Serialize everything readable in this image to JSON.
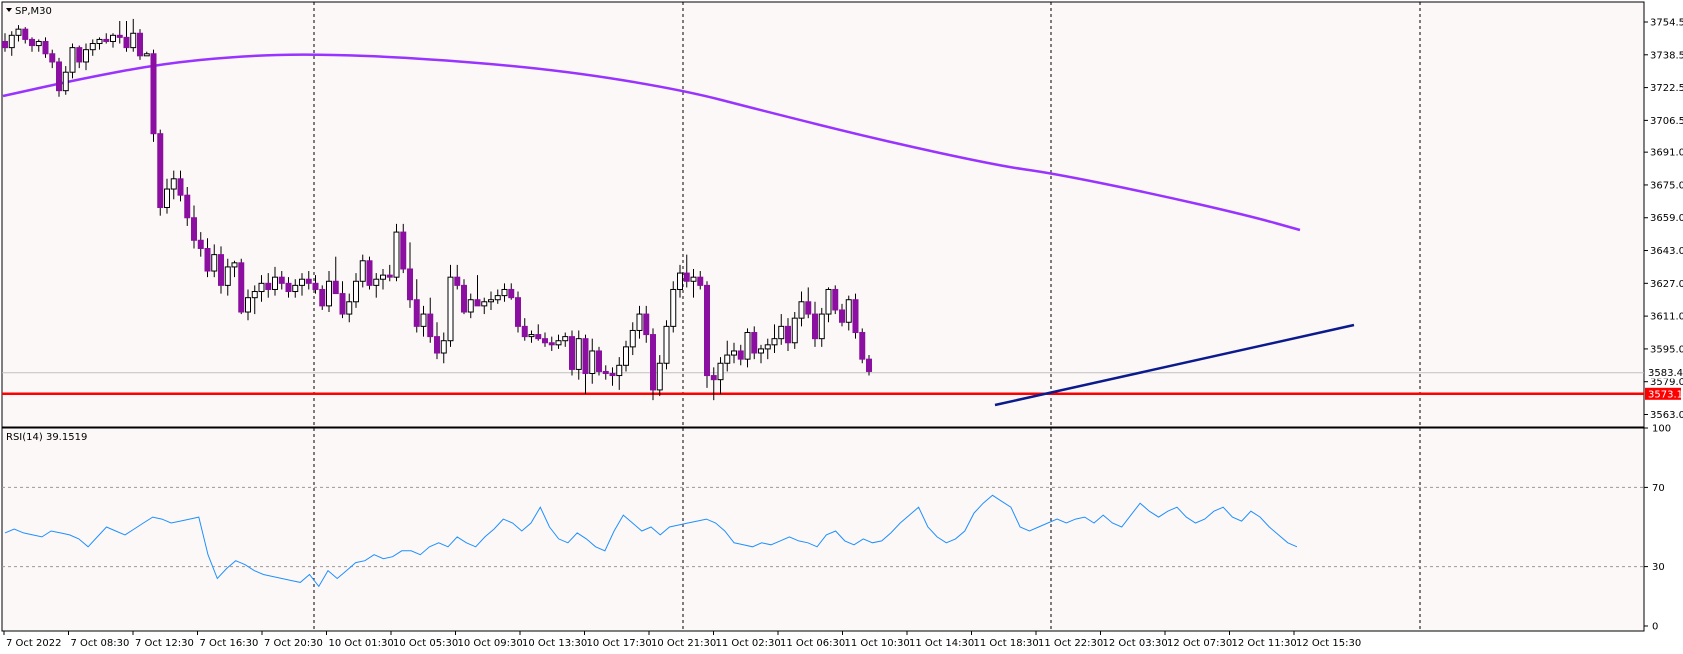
{
  "window": {
    "symbol_timeframe": "SP,M30",
    "rsi_label": "RSI(14) 39.1519"
  },
  "colors": {
    "background": "#fdf8f8",
    "bull_candle": "#ffffff",
    "bear_candle": "#8b0fa0",
    "moving_average": "#9933ff",
    "trendline": "#0b1a8c",
    "support_line": "#ff0000",
    "rsi_line": "#1e90ff",
    "current_price_line": "#c0c0c0"
  },
  "chart_data": [
    {
      "type": "candlestick",
      "title": "SP,M30",
      "y_ticks": [
        "3754.5",
        "3738.5",
        "3722.5",
        "3706.5",
        "3691.0",
        "3675.0",
        "3659.0",
        "3643.0",
        "3627.0",
        "3611.0",
        "3595.0",
        "3579.0",
        "3563.0"
      ],
      "ylim": [
        3558,
        3762
      ],
      "x_ticks": [
        "7 Oct 2022",
        "7 Oct 08:30",
        "7 Oct 12:30",
        "7 Oct 16:30",
        "7 Oct 20:30",
        "10 Oct 01:30",
        "10 Oct 05:30",
        "10 Oct 09:30",
        "10 Oct 13:30",
        "10 Oct 17:30",
        "10 Oct 21:30",
        "11 Oct 02:30",
        "11 Oct 06:30",
        "11 Oct 10:30",
        "11 Oct 14:30",
        "11 Oct 18:30",
        "11 Oct 22:30",
        "12 Oct 03:30",
        "12 Oct 07:30",
        "12 Oct 11:30",
        "12 Oct 15:30"
      ],
      "grid": "vertical dashed separators",
      "current_price": {
        "value": 3583.4,
        "label": "3583.4"
      },
      "support_level": {
        "value": 3573.1,
        "label": "3573.1"
      },
      "ohlc": [
        [
          3745,
          3749,
          3740,
          3742
        ],
        [
          3742,
          3750,
          3738,
          3748
        ],
        [
          3748,
          3753,
          3745,
          3751
        ],
        [
          3751,
          3752,
          3744,
          3746
        ],
        [
          3746,
          3747,
          3740,
          3743
        ],
        [
          3743,
          3746,
          3740,
          3745
        ],
        [
          3745,
          3747,
          3737,
          3739
        ],
        [
          3739,
          3741,
          3732,
          3735
        ],
        [
          3735,
          3737,
          3718,
          3721
        ],
        [
          3721,
          3733,
          3719,
          3730
        ],
        [
          3730,
          3744,
          3727,
          3742
        ],
        [
          3742,
          3743,
          3732,
          3735
        ],
        [
          3735,
          3744,
          3731,
          3741
        ],
        [
          3741,
          3746,
          3738,
          3744
        ],
        [
          3744,
          3747,
          3741,
          3746
        ],
        [
          3746,
          3749,
          3744,
          3745
        ],
        [
          3745,
          3749,
          3742,
          3748
        ],
        [
          3748,
          3755,
          3744,
          3747
        ],
        [
          3747,
          3755,
          3740,
          3742
        ],
        [
          3742,
          3756,
          3740,
          3749
        ],
        [
          3749,
          3751,
          3736,
          3738
        ],
        [
          3738,
          3740,
          3738,
          3739
        ],
        [
          3739,
          3741,
          3696,
          3700
        ],
        [
          3700,
          3702,
          3660,
          3664
        ],
        [
          3664,
          3678,
          3661,
          3673
        ],
        [
          3673,
          3682,
          3668,
          3678
        ],
        [
          3678,
          3682,
          3667,
          3670
        ],
        [
          3670,
          3674,
          3655,
          3659
        ],
        [
          3659,
          3665,
          3644,
          3648
        ],
        [
          3648,
          3652,
          3640,
          3644
        ],
        [
          3644,
          3649,
          3630,
          3633
        ],
        [
          3633,
          3646,
          3630,
          3641
        ],
        [
          3641,
          3645,
          3622,
          3626
        ],
        [
          3626,
          3639,
          3621,
          3635
        ],
        [
          3635,
          3638,
          3630,
          3637
        ],
        [
          3637,
          3639,
          3612,
          3613
        ],
        [
          3613,
          3624,
          3609,
          3620
        ],
        [
          3620,
          3626,
          3612,
          3623
        ],
        [
          3623,
          3631,
          3618,
          3627
        ],
        [
          3627,
          3632,
          3620,
          3624
        ],
        [
          3624,
          3635,
          3621,
          3630
        ],
        [
          3630,
          3633,
          3624,
          3627
        ],
        [
          3627,
          3630,
          3620,
          3623
        ],
        [
          3623,
          3629,
          3620,
          3626
        ],
        [
          3626,
          3632,
          3621,
          3629
        ],
        [
          3629,
          3633,
          3624,
          3627
        ],
        [
          3627,
          3631,
          3622,
          3624
        ],
        [
          3624,
          3626,
          3614,
          3616
        ],
        [
          3616,
          3633,
          3613,
          3628
        ],
        [
          3628,
          3640,
          3622,
          3622
        ],
        [
          3622,
          3628,
          3610,
          3612
        ],
        [
          3612,
          3622,
          3608,
          3618
        ],
        [
          3618,
          3632,
          3615,
          3628
        ],
        [
          3628,
          3641,
          3625,
          3638
        ],
        [
          3638,
          3640,
          3624,
          3626
        ],
        [
          3626,
          3632,
          3620,
          3629
        ],
        [
          3629,
          3634,
          3624,
          3631
        ],
        [
          3631,
          3636,
          3628,
          3630
        ],
        [
          3630,
          3656,
          3628,
          3652
        ],
        [
          3652,
          3656,
          3632,
          3634
        ],
        [
          3634,
          3647,
          3615,
          3619
        ],
        [
          3619,
          3629,
          3603,
          3606
        ],
        [
          3606,
          3616,
          3601,
          3612
        ],
        [
          3612,
          3620,
          3598,
          3601
        ],
        [
          3601,
          3608,
          3590,
          3593
        ],
        [
          3593,
          3603,
          3588,
          3599
        ],
        [
          3599,
          3636,
          3596,
          3630
        ],
        [
          3630,
          3636,
          3624,
          3626
        ],
        [
          3626,
          3629,
          3612,
          3613
        ],
        [
          3613,
          3622,
          3610,
          3619
        ],
        [
          3619,
          3631,
          3616,
          3616
        ],
        [
          3616,
          3620,
          3612,
          3618
        ],
        [
          3618,
          3623,
          3614,
          3619
        ],
        [
          3619,
          3624,
          3617,
          3621
        ],
        [
          3621,
          3627,
          3618,
          3624
        ],
        [
          3624,
          3627,
          3619,
          3620
        ],
        [
          3620,
          3623,
          3603,
          3606
        ],
        [
          3606,
          3610,
          3599,
          3601
        ],
        [
          3601,
          3604,
          3598,
          3602
        ],
        [
          3602,
          3607,
          3599,
          3600
        ],
        [
          3600,
          3603,
          3596,
          3598
        ],
        [
          3598,
          3601,
          3594,
          3597
        ],
        [
          3597,
          3602,
          3595,
          3599
        ],
        [
          3599,
          3603,
          3596,
          3601
        ],
        [
          3601,
          3604,
          3582,
          3585
        ],
        [
          3585,
          3604,
          3580,
          3600
        ],
        [
          3600,
          3602,
          3573,
          3583
        ],
        [
          3583,
          3600,
          3578,
          3594
        ],
        [
          3594,
          3596,
          3582,
          3584
        ],
        [
          3584,
          3587,
          3580,
          3583
        ],
        [
          3583,
          3586,
          3577,
          3582
        ],
        [
          3582,
          3591,
          3575,
          3587
        ],
        [
          3587,
          3599,
          3584,
          3596
        ],
        [
          3596,
          3608,
          3592,
          3604
        ],
        [
          3604,
          3616,
          3600,
          3612
        ],
        [
          3612,
          3616,
          3598,
          3602
        ],
        [
          3602,
          3605,
          3570,
          3575
        ],
        [
          3575,
          3592,
          3572,
          3588
        ],
        [
          3588,
          3609,
          3585,
          3606
        ],
        [
          3606,
          3628,
          3603,
          3624
        ],
        [
          3624,
          3636,
          3620,
          3632
        ],
        [
          3632,
          3641,
          3625,
          3628
        ],
        [
          3628,
          3634,
          3620,
          3630
        ],
        [
          3630,
          3633,
          3624,
          3626
        ],
        [
          3626,
          3628,
          3576,
          3582
        ],
        [
          3582,
          3586,
          3570,
          3580
        ],
        [
          3580,
          3591,
          3573,
          3588
        ],
        [
          3588,
          3599,
          3584,
          3592
        ],
        [
          3592,
          3598,
          3588,
          3594
        ],
        [
          3594,
          3597,
          3587,
          3590
        ],
        [
          3590,
          3605,
          3586,
          3603
        ],
        [
          3603,
          3606,
          3590,
          3593
        ],
        [
          3593,
          3597,
          3588,
          3595
        ],
        [
          3595,
          3600,
          3590,
          3597
        ],
        [
          3597,
          3607,
          3593,
          3600
        ],
        [
          3600,
          3612,
          3597,
          3606
        ],
        [
          3606,
          3610,
          3594,
          3598
        ],
        [
          3598,
          3613,
          3595,
          3610
        ],
        [
          3610,
          3623,
          3606,
          3618
        ],
        [
          3618,
          3625,
          3610,
          3612
        ],
        [
          3612,
          3618,
          3596,
          3600
        ],
        [
          3600,
          3615,
          3596,
          3612
        ],
        [
          3612,
          3625,
          3608,
          3624
        ],
        [
          3624,
          3626,
          3612,
          3614
        ],
        [
          3614,
          3617,
          3606,
          3608
        ],
        [
          3608,
          3621,
          3604,
          3619
        ],
        [
          3619,
          3622,
          3600,
          3603
        ],
        [
          3603,
          3605,
          3588,
          3590
        ],
        [
          3590,
          3592,
          3582,
          3584
        ]
      ]
    },
    {
      "type": "line",
      "title": "RSI(14) 39.1519",
      "y_ticks": [
        "100",
        "70",
        "30",
        "0"
      ],
      "ylim": [
        0,
        100
      ],
      "levels": [
        70,
        30
      ],
      "values": [
        47,
        49,
        47,
        46,
        45,
        48,
        47,
        46,
        44,
        40,
        45,
        50,
        48,
        46,
        49,
        52,
        55,
        54,
        52,
        53,
        54,
        55,
        36,
        24,
        29,
        33,
        31,
        28,
        26,
        25,
        24,
        23,
        22,
        26,
        20,
        28,
        24,
        28,
        32,
        33,
        36,
        34,
        35,
        38,
        38,
        36,
        40,
        42,
        40,
        45,
        42,
        40,
        45,
        49,
        54,
        52,
        48,
        52,
        60,
        50,
        44,
        42,
        47,
        44,
        40,
        38,
        48,
        56,
        52,
        48,
        50,
        46,
        50,
        51,
        52,
        53,
        54,
        52,
        48,
        42,
        41,
        40,
        42,
        41,
        43,
        45,
        43,
        42,
        40,
        46,
        48,
        43,
        41,
        44,
        42,
        43,
        47,
        52,
        56,
        60,
        50,
        45,
        42,
        44,
        48,
        57,
        62,
        66,
        63,
        60,
        50,
        48,
        50,
        52,
        54,
        52,
        54,
        55,
        52,
        56,
        52,
        50,
        56,
        62,
        58,
        55,
        58,
        60,
        55,
        52,
        54,
        58,
        60,
        55,
        53,
        58,
        55,
        50,
        46,
        42,
        40
      ]
    }
  ]
}
